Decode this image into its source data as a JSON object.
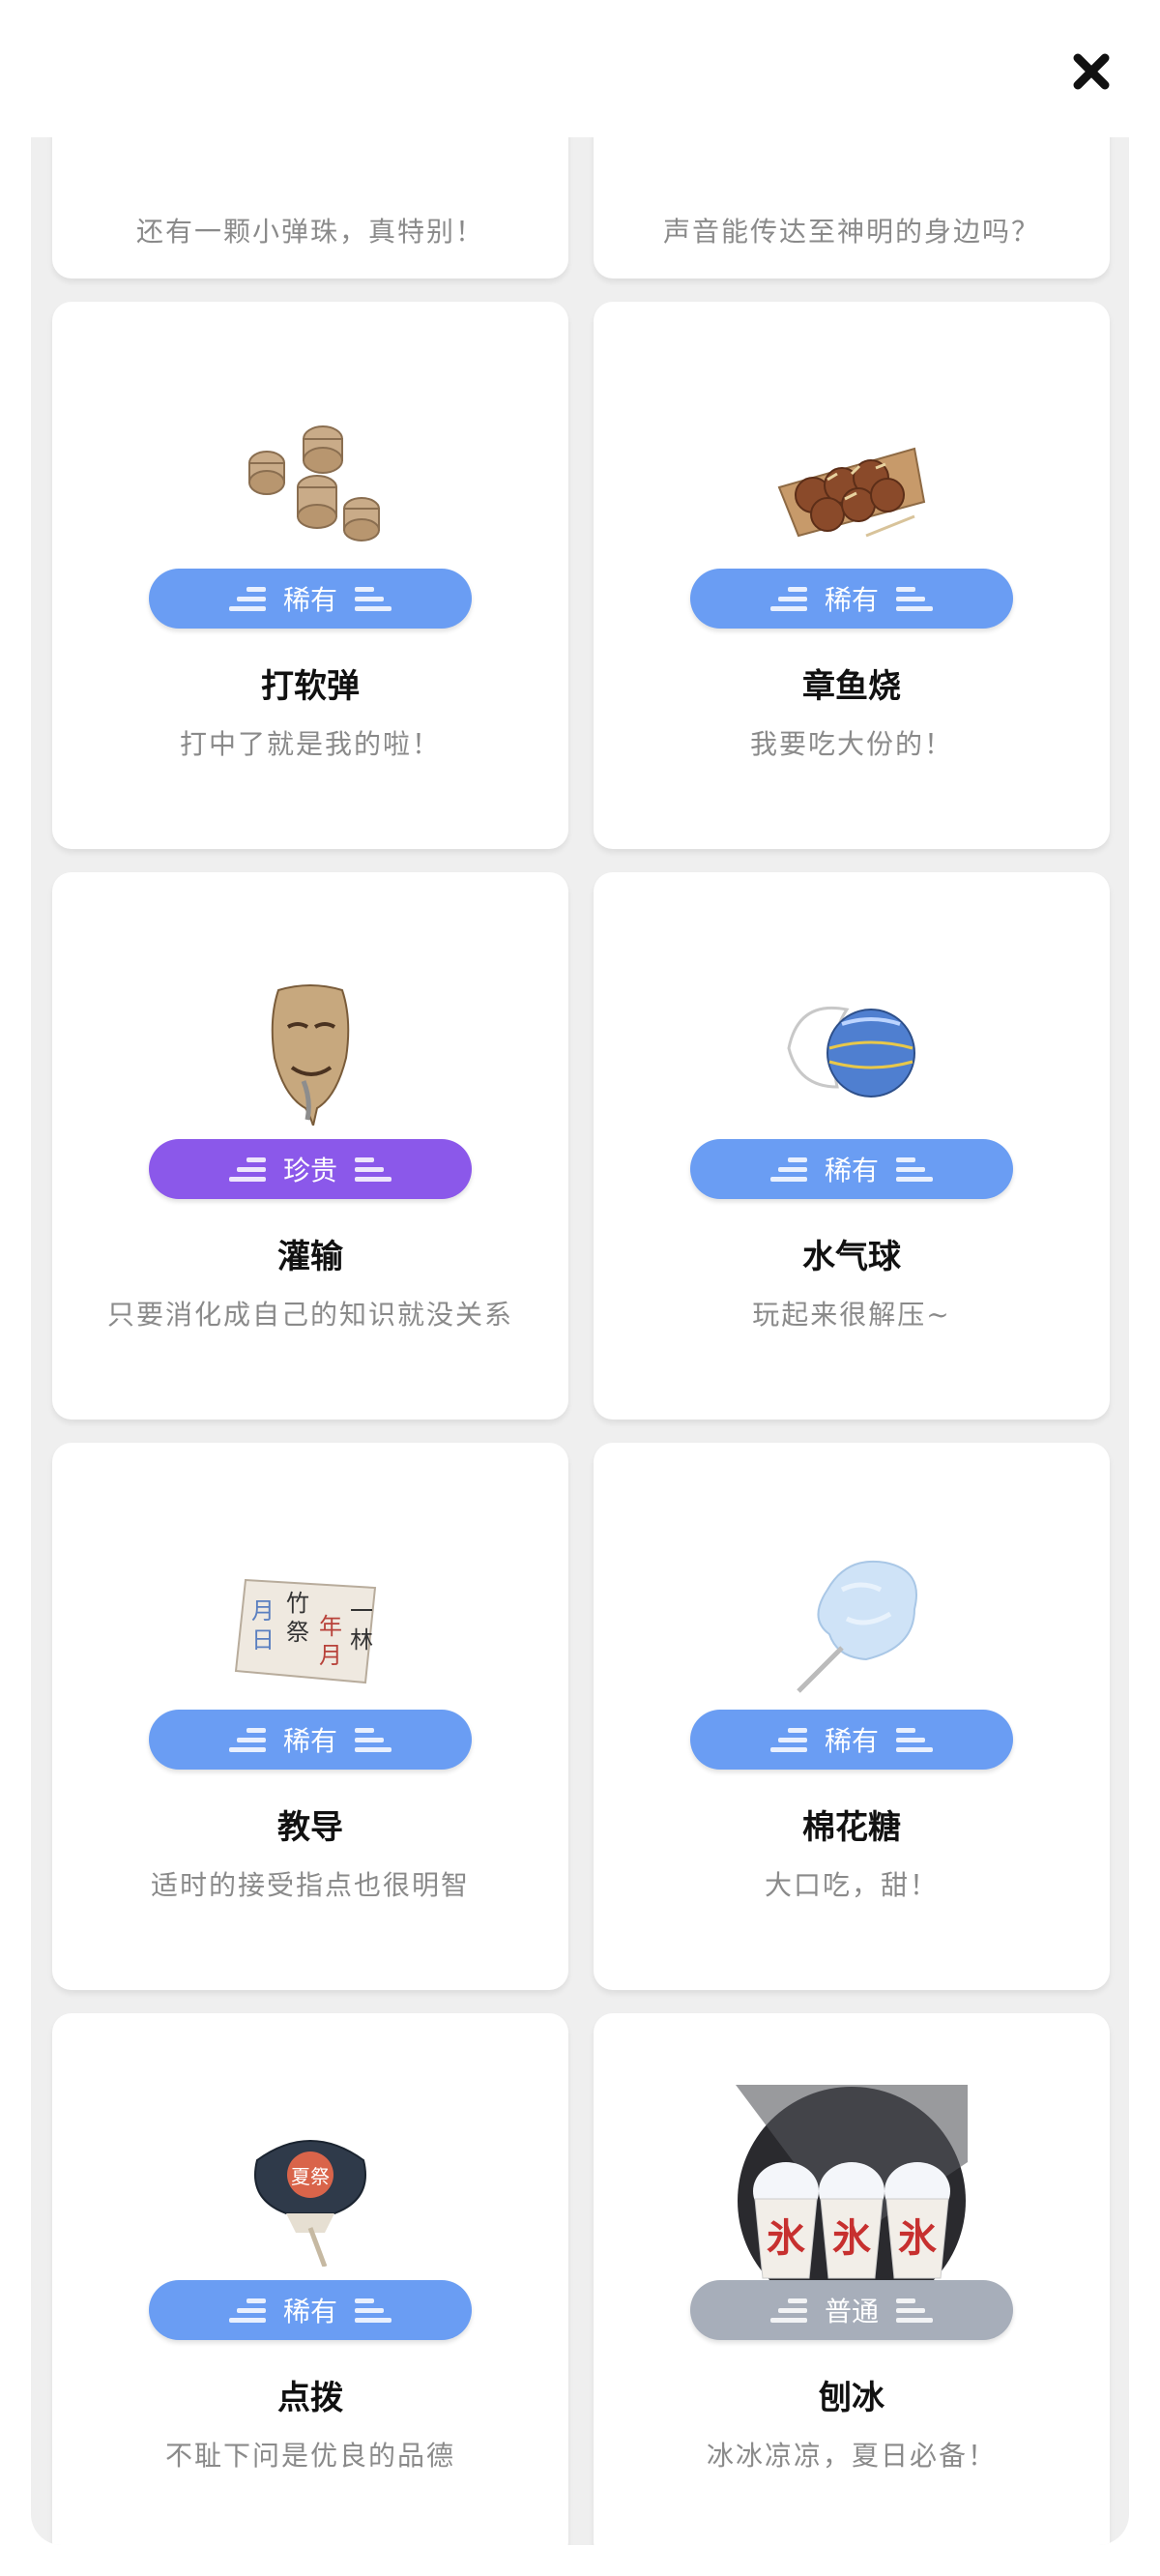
{
  "header": {
    "close_icon": "close-icon"
  },
  "colors": {
    "rare": "#6a9df3",
    "precious": "#8b58ea",
    "common": "#a7aeba",
    "background": "#efefef"
  },
  "items": [
    {
      "name": "",
      "desc": "还有一颗小弹珠，真特别！",
      "rarity": "",
      "icon": ""
    },
    {
      "name": "",
      "desc": "声音能传达至神明的身边吗？",
      "rarity": "",
      "icon": ""
    },
    {
      "name": "打软弹",
      "desc": "打中了就是我的啦！",
      "rarity": "稀有",
      "icon": "cork-pellets-icon"
    },
    {
      "name": "章鱼烧",
      "desc": "我要吃大份的！",
      "rarity": "稀有",
      "icon": "takoyaki-icon"
    },
    {
      "name": "灌输",
      "desc": "只要消化成自己的知识就没关系",
      "rarity": "珍贵",
      "icon": "noh-mask-icon"
    },
    {
      "name": "水气球",
      "desc": "玩起来很解压~",
      "rarity": "稀有",
      "icon": "water-balloon-icon"
    },
    {
      "name": "教导",
      "desc": "适时的接受指点也很明智",
      "rarity": "稀有",
      "icon": "calligraphy-paper-icon"
    },
    {
      "name": "棉花糖",
      "desc": "大口吃，甜！",
      "rarity": "稀有",
      "icon": "cotton-candy-icon"
    },
    {
      "name": "点拨",
      "desc": "不耻下问是优良的品德",
      "rarity": "稀有",
      "icon": "hand-fan-icon"
    },
    {
      "name": "刨冰",
      "desc": "冰冰凉凉，夏日必备！",
      "rarity": "普通",
      "icon": "shaved-ice-icon"
    }
  ],
  "paper_text": {
    "c1": "月日",
    "c2": "竹祭",
    "c3": "年月",
    "c4": "一林"
  },
  "fan_text": "夏祭",
  "ice_text": "氷"
}
